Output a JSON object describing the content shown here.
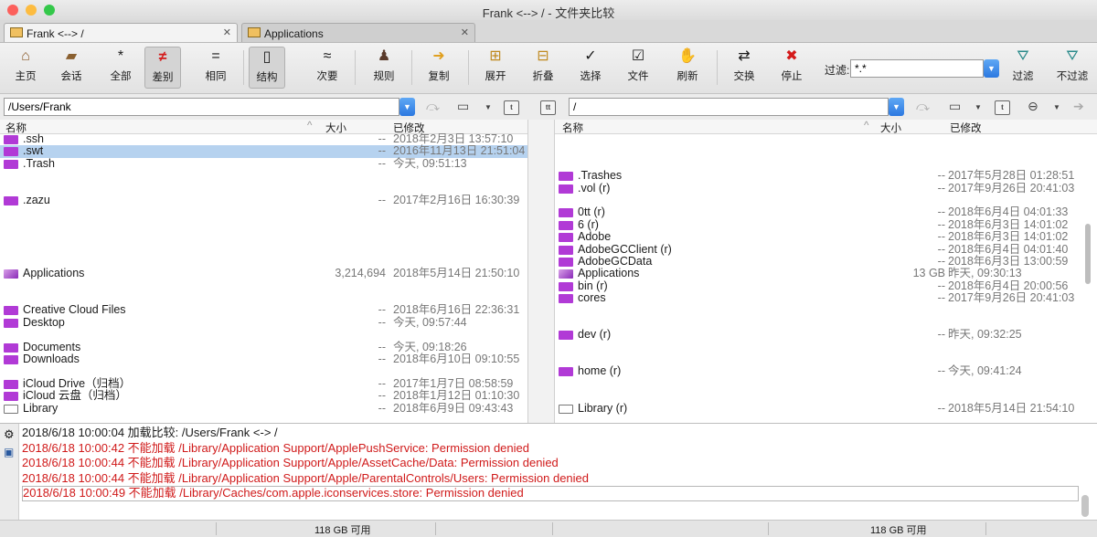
{
  "window": {
    "title": "Frank <--> / - 文件夹比较"
  },
  "tabs": [
    {
      "label": "Frank <--> /",
      "close": "✕"
    },
    {
      "label": "Applications",
      "close": "✕"
    }
  ],
  "toolbar": {
    "home": "主页",
    "session": "会话",
    "all": "全部",
    "diff": "差别",
    "same": "相同",
    "structure": "结构",
    "minor": "次要",
    "rules": "规则",
    "copy": "复制",
    "expand": "展开",
    "collapse": "折叠",
    "select": "选择",
    "files": "文件",
    "refresh": "刷新",
    "swap": "交换",
    "stop": "停止",
    "filter_label": "过滤:",
    "filter_value": "*.*",
    "filter": "过滤",
    "no_filter": "不过滤"
  },
  "left": {
    "path": "/Users/Frank",
    "headers": {
      "name": "名称",
      "size": "大小",
      "modified": "已修改"
    },
    "rows": [
      {
        "name": ".ssh",
        "size": "--",
        "date": "2018年2月3日 13:57:10",
        "icon": "folder"
      },
      {
        "name": ".swt",
        "size": "--",
        "date": "2016年11月13日 21:51:04",
        "icon": "folder",
        "selected": true
      },
      {
        "name": ".Trash",
        "size": "--",
        "date": "今天, 09:51:13",
        "icon": "folder"
      },
      {
        "name": "",
        "size": "",
        "date": ""
      },
      {
        "name": "",
        "size": "",
        "date": ""
      },
      {
        "name": ".zazu",
        "size": "--",
        "date": "2017年2月16日 16:30:39",
        "icon": "folder"
      },
      {
        "name": "",
        "size": "",
        "date": ""
      },
      {
        "name": "",
        "size": "",
        "date": ""
      },
      {
        "name": "",
        "size": "",
        "date": ""
      },
      {
        "name": "",
        "size": "",
        "date": ""
      },
      {
        "name": "",
        "size": "",
        "date": ""
      },
      {
        "name": "Applications",
        "size": "3,214,694",
        "date": "2018年5月14日 21:50:10",
        "icon": "app"
      },
      {
        "name": "",
        "size": "",
        "date": ""
      },
      {
        "name": "",
        "size": "",
        "date": ""
      },
      {
        "name": "Creative Cloud Files",
        "size": "--",
        "date": "2018年6月16日 22:36:31",
        "icon": "folder"
      },
      {
        "name": "Desktop",
        "size": "--",
        "date": "今天, 09:57:44",
        "icon": "folder"
      },
      {
        "name": "",
        "size": "",
        "date": ""
      },
      {
        "name": "Documents",
        "size": "--",
        "date": "今天, 09:18:26",
        "icon": "folder"
      },
      {
        "name": "Downloads",
        "size": "--",
        "date": "2018年6月10日 09:10:55",
        "icon": "folder"
      },
      {
        "name": "",
        "size": "",
        "date": ""
      },
      {
        "name": "iCloud Drive（归档）",
        "size": "--",
        "date": "2017年1月7日 08:58:59",
        "icon": "folder"
      },
      {
        "name": "iCloud 云盘（归档）",
        "size": "--",
        "date": "2018年1月12日 01:10:30",
        "icon": "folder"
      },
      {
        "name": "Library",
        "size": "--",
        "date": "2018年6月9日 09:43:43",
        "icon": "lib"
      }
    ]
  },
  "right": {
    "path": "/",
    "headers": {
      "name": "名称",
      "size": "大小",
      "modified": "已修改"
    },
    "rows": [
      {
        "name": "",
        "size": "",
        "date": ""
      },
      {
        "name": "",
        "size": "",
        "date": ""
      },
      {
        "name": "",
        "size": "",
        "date": ""
      },
      {
        "name": ".Trashes",
        "size": "--",
        "date": "2017年5月28日 01:28:51",
        "icon": "folder"
      },
      {
        "name": ".vol (r)",
        "size": "--",
        "date": "2017年9月26日 20:41:03",
        "icon": "folder"
      },
      {
        "name": "",
        "size": "",
        "date": ""
      },
      {
        "name": "0tt (r)",
        "size": "--",
        "date": "2018年6月4日 04:01:33",
        "icon": "folder"
      },
      {
        "name": "6 (r)",
        "size": "--",
        "date": "2018年6月3日 14:01:02",
        "icon": "folder"
      },
      {
        "name": "Adobe",
        "size": "--",
        "date": "2018年6月3日 14:01:02",
        "icon": "folder"
      },
      {
        "name": "AdobeGCClient (r)",
        "size": "--",
        "date": "2018年6月4日 04:01:40",
        "icon": "folder"
      },
      {
        "name": "AdobeGCData",
        "size": "--",
        "date": "2018年6月3日 13:00:59",
        "icon": "folder"
      },
      {
        "name": "Applications",
        "size": "13 GB",
        "date": "昨天, 09:30:13",
        "icon": "app"
      },
      {
        "name": "bin (r)",
        "size": "--",
        "date": "2018年6月4日 20:00:56",
        "icon": "folder"
      },
      {
        "name": "cores",
        "size": "--",
        "date": "2017年9月26日 20:41:03",
        "icon": "folder"
      },
      {
        "name": "",
        "size": "",
        "date": ""
      },
      {
        "name": "",
        "size": "",
        "date": ""
      },
      {
        "name": "dev (r)",
        "size": "--",
        "date": "昨天, 09:32:25",
        "icon": "folder"
      },
      {
        "name": "",
        "size": "",
        "date": ""
      },
      {
        "name": "",
        "size": "",
        "date": ""
      },
      {
        "name": "home (r)",
        "size": "--",
        "date": "今天, 09:41:24",
        "icon": "folder"
      },
      {
        "name": "",
        "size": "",
        "date": ""
      },
      {
        "name": "",
        "size": "",
        "date": ""
      },
      {
        "name": "Library (r)",
        "size": "--",
        "date": "2018年5月14日 21:54:10",
        "icon": "lib"
      }
    ]
  },
  "log": [
    {
      "text": "2018/6/18 10:00:04  加载比较: /Users/Frank <-> /",
      "error": false
    },
    {
      "text": "2018/6/18 10:00:42  不能加载 /Library/Application Support/ApplePushService: Permission denied",
      "error": true
    },
    {
      "text": "2018/6/18 10:00:44  不能加载 /Library/Application Support/Apple/AssetCache/Data: Permission denied",
      "error": true
    },
    {
      "text": "2018/6/18 10:00:44  不能加载 /Library/Application Support/Apple/ParentalControls/Users: Permission denied",
      "error": true
    },
    {
      "text": "2018/6/18 10:00:49  不能加载 /Library/Caches/com.apple.iconservices.store: Permission denied",
      "error": true
    }
  ],
  "status": {
    "left_free": "118 GB 可用",
    "right_free": "118 GB 可用"
  },
  "colors": {
    "selection": "#b6d2ef",
    "folder": "#b13ad6",
    "error": "#d01a1a",
    "accent": "#2b78e0"
  }
}
